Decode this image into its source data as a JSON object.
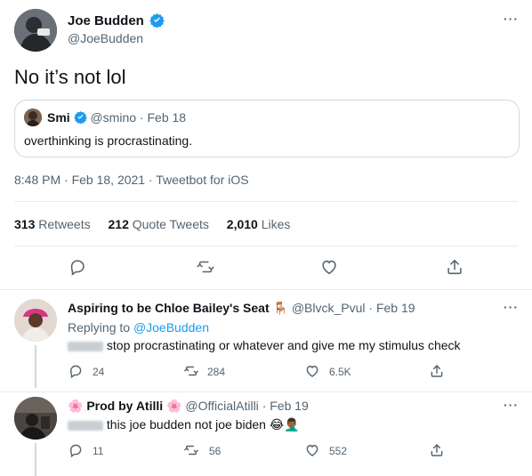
{
  "main_tweet": {
    "author_name": "Joe Budden",
    "author_handle": "@JoeBudden",
    "text": "No it’s not lol",
    "quoted": {
      "author_name": "Smi",
      "author_handle": "@smino",
      "separator": "·",
      "date": "Feb 18",
      "text": "overthinking is procrastinating."
    },
    "timestamp": "8:48 PM · Feb 18, 2021 · Tweetbot for iOS",
    "stats": {
      "retweets_count": "313",
      "retweets_label": "Retweets",
      "quotes_count": "212",
      "quotes_label": "Quote Tweets",
      "likes_count": "2,010",
      "likes_label": "Likes"
    }
  },
  "replies": [
    {
      "author_name": "Aspiring to be Chloe Bailey's Seat",
      "author_emoji": "🪑",
      "author_handle": "@Blvck_Pvul",
      "separator": "·",
      "date": "Feb 19",
      "replying_prefix": "Replying to",
      "replying_handle": "@JoeBudden",
      "text": "stop procrastinating or whatever and give me my stimulus check",
      "reply_count": "24",
      "retweet_count": "284",
      "like_count": "6.5K"
    },
    {
      "author_name": "Prod by Atilli",
      "author_prefix_emoji": "🌸",
      "author_suffix_emoji": "🌸",
      "author_handle": "@OfficialAtilli",
      "separator": "·",
      "date": "Feb 19",
      "text": "this joe budden not joe biden",
      "text_emoji": "😂🤦🏾‍♂️",
      "reply_count": "11",
      "retweet_count": "56",
      "like_count": "552"
    }
  ],
  "more_icon_glyph": "···",
  "colors": {
    "accent": "#1d9bf0",
    "text": "#0f1419",
    "muted": "#536471",
    "border": "#cfd9de",
    "divider": "#e6ecf0"
  }
}
